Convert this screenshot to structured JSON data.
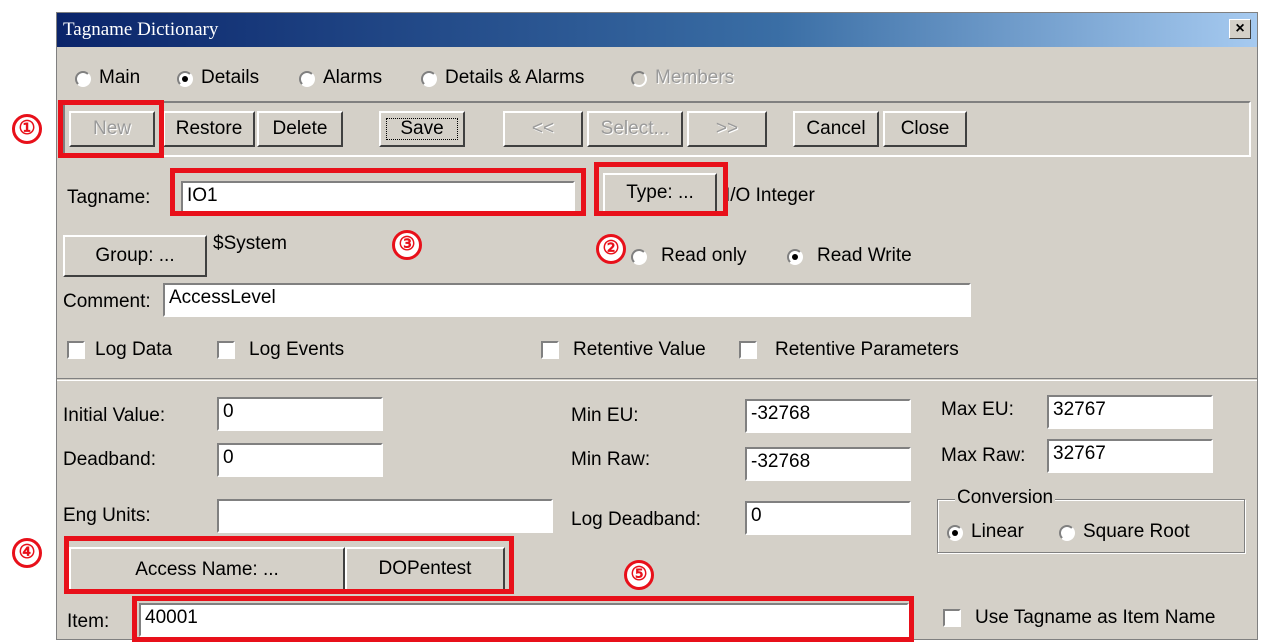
{
  "window": {
    "title": "Tagname Dictionary",
    "close_glyph": "×"
  },
  "views": [
    {
      "label": "Main",
      "selected": false,
      "enabled": true
    },
    {
      "label": "Details",
      "selected": true,
      "enabled": true
    },
    {
      "label": "Alarms",
      "selected": false,
      "enabled": true
    },
    {
      "label": "Details & Alarms",
      "selected": false,
      "enabled": true
    },
    {
      "label": "Members",
      "selected": false,
      "enabled": false
    }
  ],
  "toolbar": {
    "new": "New",
    "restore": "Restore",
    "delete": "Delete",
    "save": "Save",
    "prev": "<<",
    "select": "Select...",
    "next": ">>",
    "cancel": "Cancel",
    "close": "Close"
  },
  "tag": {
    "tagname_label": "Tagname:",
    "tagname_value": "IO1",
    "type_button": "Type: ...",
    "type_value": "I/O Integer",
    "group_button": "Group: ...",
    "group_value": "$System",
    "read_only": "Read only",
    "read_write": "Read Write",
    "comment_label": "Comment:",
    "comment_value": "AccessLevel"
  },
  "checks": {
    "log_data": "Log Data",
    "log_events": "Log Events",
    "retentive_value": "Retentive Value",
    "retentive_parameters": "Retentive Parameters"
  },
  "details": {
    "initial_value_label": "Initial Value:",
    "initial_value": "0",
    "deadband_label": "Deadband:",
    "deadband": "0",
    "eng_units_label": "Eng Units:",
    "eng_units": "",
    "min_eu_label": "Min EU:",
    "min_eu": "-32768",
    "min_raw_label": "Min Raw:",
    "min_raw": "-32768",
    "log_deadband_label": "Log Deadband:",
    "log_deadband": "0",
    "max_eu_label": "Max EU:",
    "max_eu": "32767",
    "max_raw_label": "Max Raw:",
    "max_raw": "32767",
    "conversion_label": "Conversion",
    "linear": "Linear",
    "square_root": "Square Root",
    "access_name_button": "Access Name: ...",
    "access_name_value": "DOPentest",
    "item_label": "Item:",
    "item_value": "40001",
    "use_tagname": "Use Tagname as Item Name"
  },
  "annotations": [
    "①",
    "②",
    "③",
    "④",
    "⑤"
  ],
  "colors": {
    "highlight": "#e8101a",
    "title_bar": "#0a246a",
    "face": "#d4d0c8"
  }
}
